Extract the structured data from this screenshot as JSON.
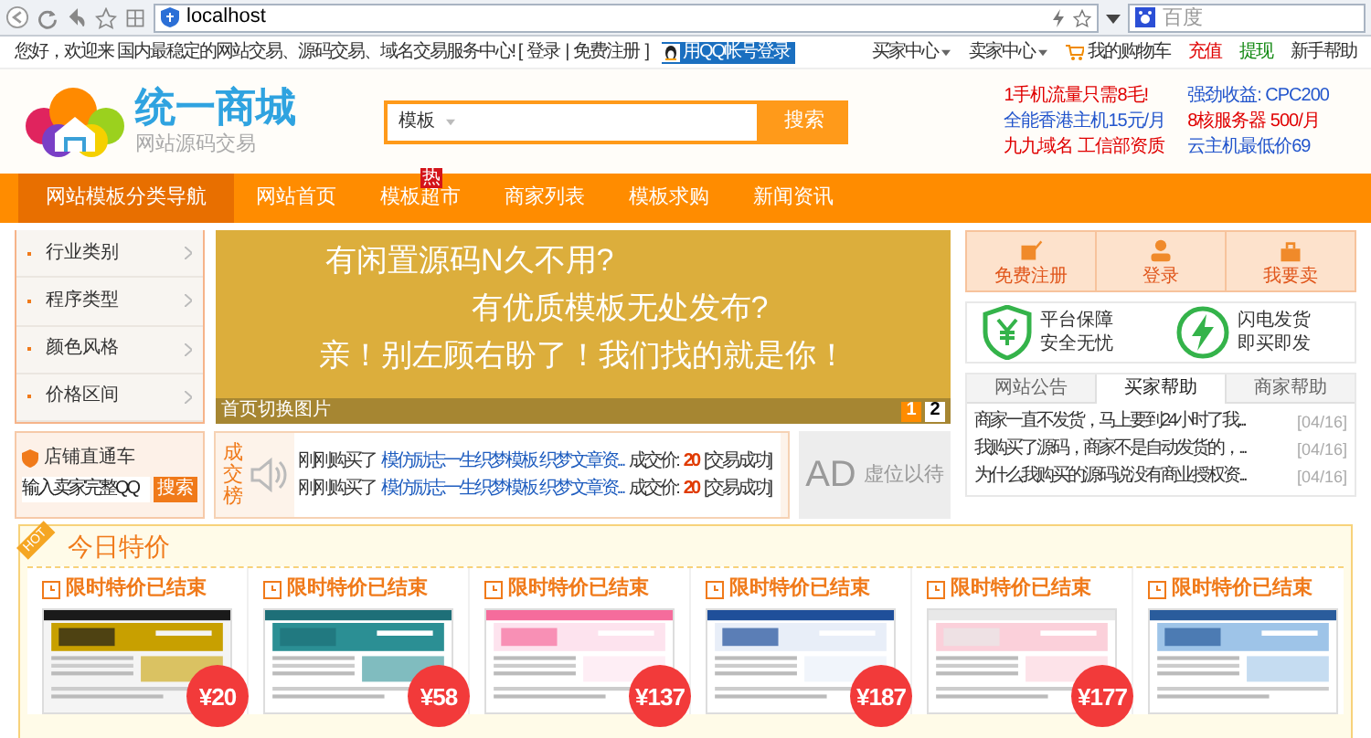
{
  "browser": {
    "url": "localhost",
    "search_placeholder": "百度"
  },
  "top_bar": {
    "welcome": "您好，欢迎来 国内最稳定的网站交易、源码交易、域名交易服务中心! [",
    "login": "登录",
    "sep": "|",
    "register": "免费注册",
    "close": "]",
    "qq_button": "用QQ帐号登录",
    "links": [
      {
        "label": "买家中心",
        "kind": "menu",
        "color": "#333333"
      },
      {
        "label": "卖家中心",
        "kind": "menu",
        "color": "#333333"
      },
      {
        "label": "我的购物车",
        "kind": "cart",
        "color": "#333333"
      },
      {
        "label": "充值",
        "kind": "plain",
        "color": "#e00000"
      },
      {
        "label": "提现",
        "kind": "plain",
        "color": "#118811"
      },
      {
        "label": "新手帮助",
        "kind": "plain",
        "color": "#333333"
      }
    ]
  },
  "header": {
    "logo_title": "统一商城",
    "logo_subtitle": "网站源码交易",
    "search_category": "模板",
    "search_button": "搜索",
    "ads": [
      {
        "text": "1手机流量只需8毛!",
        "color": "#e00000"
      },
      {
        "text": "全能香港主机15元/月",
        "color": "#2255cc"
      },
      {
        "text": "九九域名 工信部资质",
        "color": "#e00000"
      },
      {
        "text": "强劲收益: CPC200",
        "color": "#2255cc"
      },
      {
        "text": "8核服务器 500/月",
        "color": "#e00000"
      },
      {
        "text": "云主机最低价69",
        "color": "#2255cc"
      }
    ]
  },
  "nav": [
    {
      "label": "网站模板分类导航",
      "selected": true
    },
    {
      "label": "网站首页",
      "selected": false
    },
    {
      "label": "模板超市",
      "selected": false,
      "badge": "热"
    },
    {
      "label": "商家列表",
      "selected": false
    },
    {
      "label": "模板求购",
      "selected": false
    },
    {
      "label": "新闻资讯",
      "selected": false
    }
  ],
  "sidebar": {
    "items": [
      "行业类别",
      "程序类型",
      "颜色风格",
      "价格区间"
    ]
  },
  "banner": {
    "lines": [
      "有闲置源码N久不用?",
      "有优质模板无处发布?",
      "亲！别左顾右盼了！我们找的就是你！"
    ],
    "caption": "首页切换图片",
    "pages": [
      {
        "label": "1",
        "selected": true
      },
      {
        "label": "2",
        "selected": false
      }
    ]
  },
  "actions": [
    {
      "label": "免费注册",
      "kind": "edit"
    },
    {
      "label": "登录",
      "kind": "user"
    },
    {
      "label": "我要卖",
      "kind": "shop"
    }
  ],
  "guarantees": [
    {
      "title": "平台保障",
      "subtitle": "安全无忧",
      "kind": "money"
    },
    {
      "title": "闪电发货",
      "subtitle": "即买即发",
      "kind": "bolt"
    }
  ],
  "help": {
    "tabs": [
      {
        "label": "网站公告",
        "selected": false
      },
      {
        "label": "买家帮助",
        "selected": true
      },
      {
        "label": "商家帮助",
        "selected": false
      }
    ],
    "items": [
      {
        "text": "商家一直不发货，马上要到24小时了我...",
        "date": "[04/16]"
      },
      {
        "text": "我购买了源码，商家不是自动发货的，...",
        "date": "[04/16]"
      },
      {
        "text": "为什么我购买的源码说没有商业授权资...",
        "date": "[04/16]"
      }
    ]
  },
  "shop_search": {
    "title": "店铺直通车",
    "placeholder": "输入卖家完整QQ",
    "button": "搜索"
  },
  "ticker": {
    "label": "成交榜",
    "rows": [
      {
        "prefix": "刚刚购买了",
        "product": "模仿励志一生织梦模板 织梦文章资...",
        "price_label": "成交价:",
        "price": "20",
        "status": "[交易成功]"
      },
      {
        "prefix": "刚刚购买了",
        "product": "模仿励志一生织梦模板 织梦文章资...",
        "price_label": "成交价:",
        "price": "20",
        "status": "[交易成功]"
      }
    ]
  },
  "ad": {
    "mark": "AD",
    "text": "虚位以待"
  },
  "specials": {
    "ribbon": "HOT",
    "title": "今日特价",
    "items": [
      {
        "label": "限时特价已结束",
        "price": "¥20"
      },
      {
        "label": "限时特价已结束",
        "price": "¥58"
      },
      {
        "label": "限时特价已结束",
        "price": "¥137"
      },
      {
        "label": "限时特价已结束",
        "price": "¥187"
      },
      {
        "label": "限时特价已结束",
        "price": "¥177"
      },
      {
        "label": "限时特价已结束"
      }
    ]
  }
}
